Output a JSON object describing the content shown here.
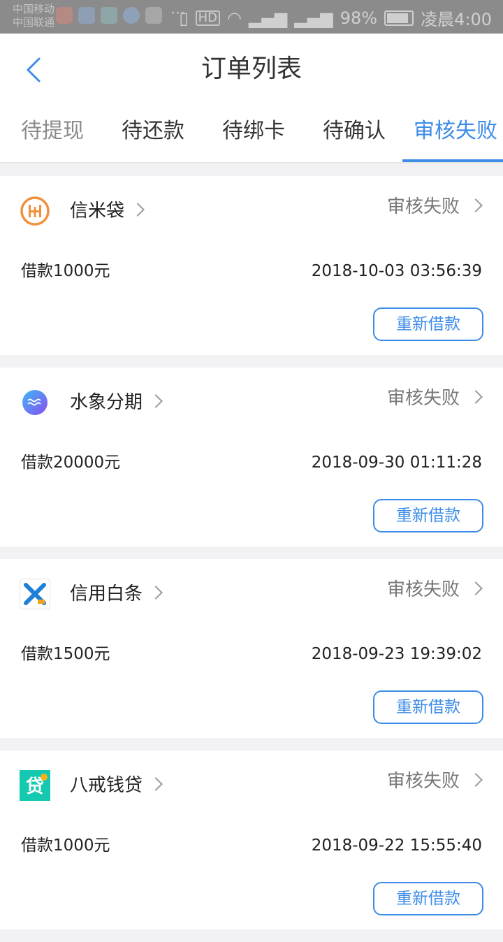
{
  "statusbar": {
    "carrier_1": "中国移动",
    "carrier_2": "中国联通",
    "hd": "HD",
    "battery_pct": "98%",
    "time": "凌晨4:00"
  },
  "header": {
    "title": "订单列表"
  },
  "tabs": [
    {
      "label": "待提现"
    },
    {
      "label": "待还款"
    },
    {
      "label": "待绑卡"
    },
    {
      "label": "待确认"
    },
    {
      "label": "审核失败"
    }
  ],
  "orders": [
    {
      "lender": "信米袋",
      "status": "审核失败",
      "amount": "借款1000元",
      "time": "2018-10-03 03:56:39",
      "action": "重新借款"
    },
    {
      "lender": "水象分期",
      "status": "审核失败",
      "amount": "借款20000元",
      "time": "2018-09-30 01:11:28",
      "action": "重新借款"
    },
    {
      "lender": "信用白条",
      "status": "审核失败",
      "amount": "借款1500元",
      "time": "2018-09-23 19:39:02",
      "action": "重新借款"
    },
    {
      "lender": "八戒钱贷",
      "status": "审核失败",
      "amount": "借款1000元",
      "time": "2018-09-22 15:55:40",
      "action": "重新借款"
    }
  ],
  "logo_texts": {
    "bajie": "贷"
  },
  "colors": {
    "accent": "#3c8ce8",
    "statusbar": "#8b8b8b"
  }
}
